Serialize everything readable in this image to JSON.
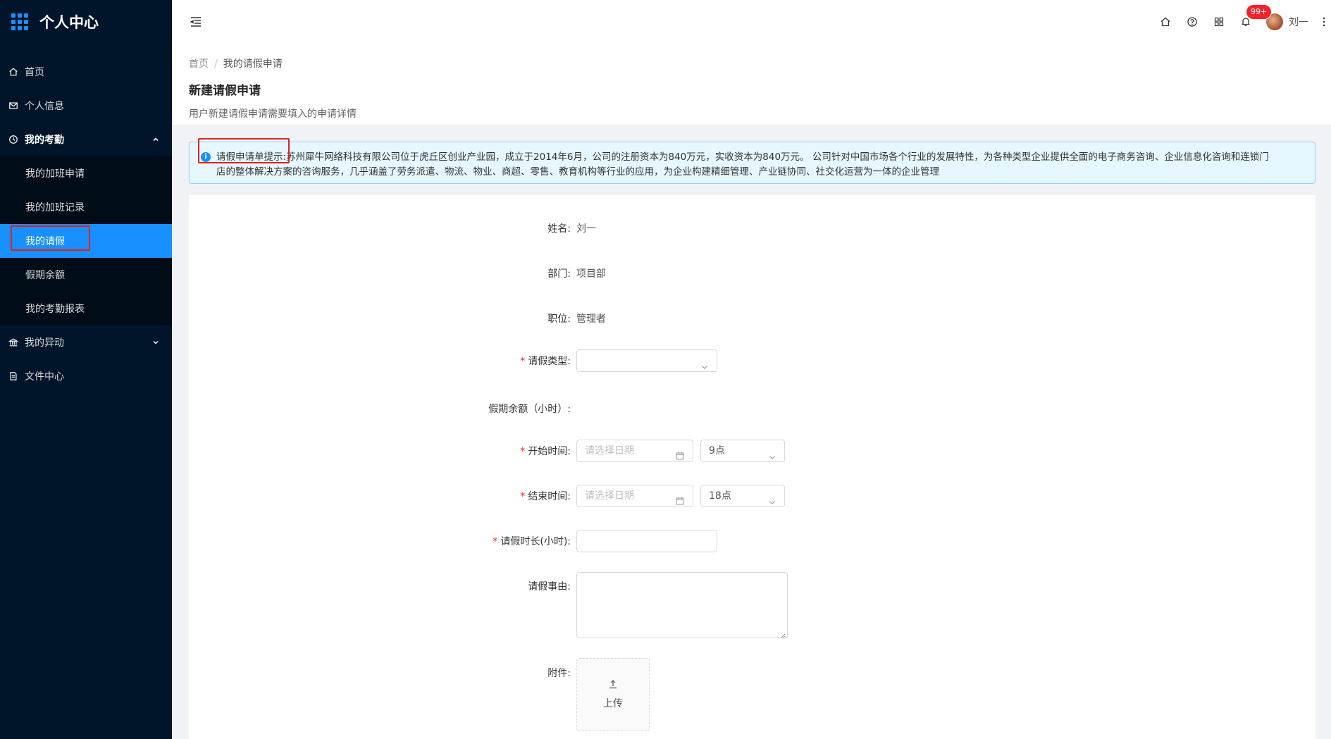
{
  "app": {
    "title": "个人中心"
  },
  "sidebar": {
    "items": [
      {
        "label": "首页",
        "icon": "home-icon"
      },
      {
        "label": "个人信息",
        "icon": "mail-icon"
      },
      {
        "label": "我的考勤",
        "icon": "clock-icon"
      },
      {
        "label": "我的异动",
        "icon": "bank-icon"
      },
      {
        "label": "文件中心",
        "icon": "file-icon"
      }
    ],
    "attendance_sub": [
      {
        "label": "我的加班申请"
      },
      {
        "label": "我的加班记录"
      },
      {
        "label": "我的请假"
      },
      {
        "label": "假期余额"
      },
      {
        "label": "我的考勤报表"
      }
    ]
  },
  "header": {
    "notification_count": "99+",
    "username": "刘一"
  },
  "breadcrumb": {
    "home": "首页",
    "current": "我的请假申请"
  },
  "page": {
    "title": "新建请假申请",
    "description": "用户新建请假申请需要填入的申请详情"
  },
  "alert": {
    "title": "请假申请单提示:",
    "line1": "苏州犀牛网络科技有限公司位于虎丘区创业产业园，成立于2014年6月，公司的注册资本为840万元，实收资本为840万元。 公司针对中国市场各个行业的发展特性，为各种类型企业提供全面的电子商务咨询、企业信息化咨询和连锁门",
    "line2": "店的整体解决方案的咨询服务，几乎涵盖了劳务派遣、物流、物业、商超、零售、教育机构等行业的应用，为企业构建精细管理、产业链协同、社交化运营为一体的企业管理"
  },
  "form": {
    "name_label": "姓名:",
    "name_value": "刘一",
    "dept_label": "部门:",
    "dept_value": "项目部",
    "position_label": "职位:",
    "position_value": "管理者",
    "leave_type_label": "请假类型:",
    "leave_type_value": "",
    "balance_label": "假期余额（小时）:",
    "start_label": "开始时间:",
    "start_date_placeholder": "请选择日期",
    "start_hour": "9点",
    "end_label": "结束时间:",
    "end_date_placeholder": "请选择日期",
    "end_hour": "18点",
    "duration_label": "请假时长(小时):",
    "reason_label": "请假事由:",
    "attachment_label": "附件:",
    "upload_label": "上传",
    "required_mark": "*"
  }
}
